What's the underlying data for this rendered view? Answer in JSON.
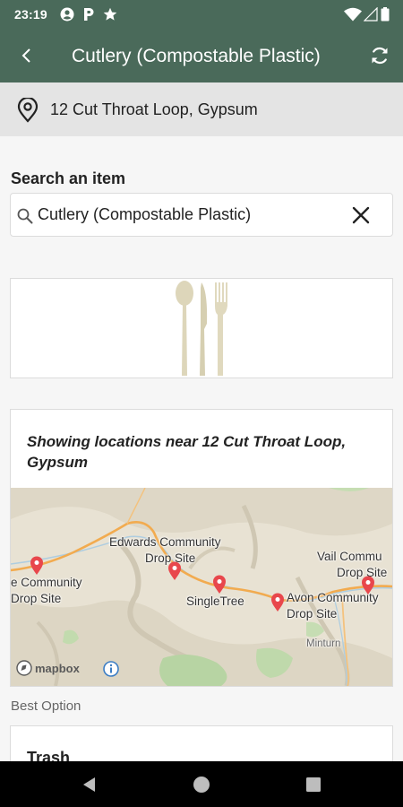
{
  "status_bar": {
    "time": "23:19",
    "icons": [
      "account-circle-icon",
      "parking-icon",
      "star-icon",
      "wifi-icon",
      "signal-icon",
      "battery-icon"
    ]
  },
  "app_bar": {
    "title": "Cutlery (Compostable Plastic)",
    "back_icon": "chevron-left-icon",
    "refresh_icon": "refresh-icon",
    "color": "#4a6a5a"
  },
  "location": {
    "icon": "map-pin-outline-icon",
    "address": "12 Cut Throat Loop, Gypsum"
  },
  "search": {
    "label": "Search an item",
    "value": "Cutlery (Compostable Plastic)",
    "search_icon": "search-icon",
    "clear_icon": "close-icon"
  },
  "item_image": {
    "description_icon": "cutlery-icon"
  },
  "map": {
    "caption": "Showing locations near 12 Cut Throat Loop, Gypsum",
    "labels": {
      "edwards_line1": "Edwards Community",
      "edwards_line2": "Drop Site",
      "eagle_line1": "e Community",
      "eagle_line2": "Drop Site",
      "singletree": "SingleTree",
      "vail_line1": "Vail Commu",
      "vail_line2": "Drop Site",
      "avon_line1": "Avon Community",
      "avon_line2": "Drop Site",
      "minturn": "Minturn"
    },
    "attribution": "mapbox",
    "pin_color": "#e8474c",
    "road_color": "#f0a64a"
  },
  "best_option": {
    "label": "Best Option",
    "title": "Trash"
  },
  "nav_bar": {
    "icons": [
      "back-triangle-icon",
      "home-circle-icon",
      "recents-square-icon"
    ]
  }
}
